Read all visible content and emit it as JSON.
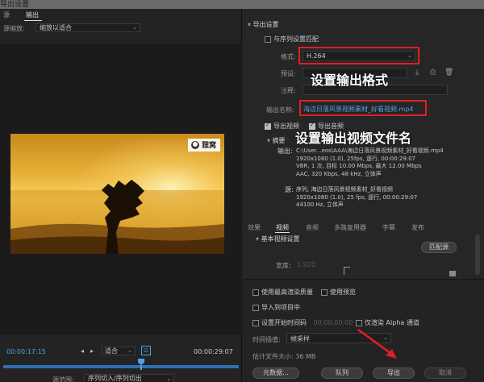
{
  "window": {
    "title": "导出设置"
  },
  "left": {
    "tabs": [
      "源",
      "输出"
    ],
    "scale_label": "源缩放:",
    "scale_value": "缩放以适合",
    "video_watermark": "狸窝",
    "timecode_current": "00:00:17:15",
    "fit_value": "适合",
    "timecode_end": "00:00:29:07",
    "source_range_label": "源范围:",
    "source_range_value": "序列切入/序列切出"
  },
  "right": {
    "export_settings_head": "导出设置",
    "match_sequence": "与序列设置匹配",
    "format_label": "格式:",
    "format_value": "H.264",
    "preset_label": "预设:",
    "comment_label": "注释:",
    "output_name_label": "输出名称:",
    "output_name_value": "海边日落风景视频素材_好看视频.mp4",
    "export_video": "导出视频",
    "export_audio": "导出音频",
    "summary_head": "摘要",
    "output_label": "输出:",
    "output_lines": [
      "C:\\User...eos\\AAA\\海边日落风景视频素材_好看视频.mp4",
      "1920x1080 (1.0), 25fps, 逐行, 00:00:29:07",
      "VBR, 1 次, 目标 10.00 Mbps, 最大 12.00 Mbps",
      "AAC, 320 Kbps, 48 kHz, 立体声"
    ],
    "source_label": "源:",
    "source_lines": [
      "序列, 海边日落风景视频素材_好看视频",
      "1920x1080 (1.0), 25 fps, 逐行, 00:00:29:07",
      "44100 Hz, 立体声"
    ],
    "tabs": [
      "效果",
      "视频",
      "音频",
      "多路复用器",
      "字幕",
      "发布"
    ],
    "basic_video_head": "基本视频设置",
    "match_source_btn": "匹配源",
    "width_label": "宽度:",
    "width_value": "1,920",
    "use_max_render": "使用最高渲染质量",
    "use_previews": "使用预览",
    "import_into_project": "导入到项目中",
    "set_start_timecode": "设置开始时间码",
    "start_timecode_value": "00;00;00;00",
    "render_alpha_only": "仅渲染 Alpha 通道",
    "time_interp_label": "时间插值:",
    "time_interp_value": "帧采样",
    "est_size": "估计文件大小: 36 MB",
    "metadata_btn": "元数据...",
    "queue_btn": "队列",
    "export_btn": "导出",
    "cancel_btn": "取消"
  },
  "annotations": {
    "format_note": "设置输出格式",
    "filename_note": "设置输出视频文件名"
  },
  "colors": {
    "accent": "#4aa3e8",
    "highlight": "#e02020"
  }
}
